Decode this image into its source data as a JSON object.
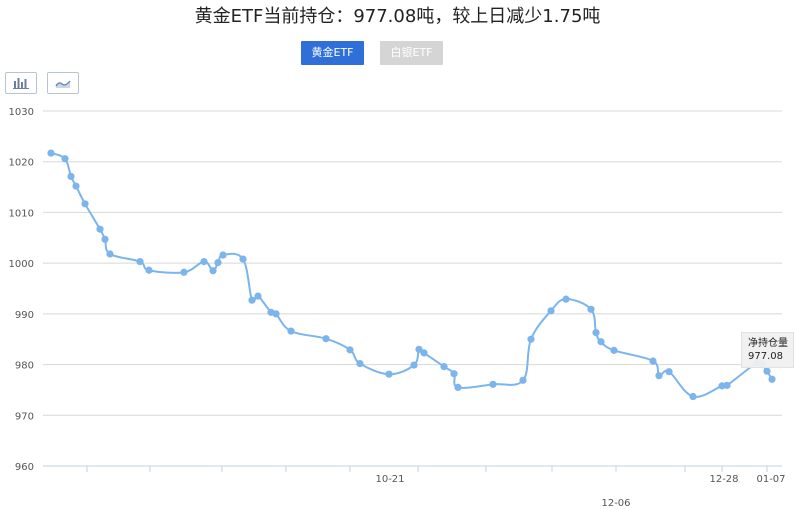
{
  "title": "黄金ETF当前持仓：977.08吨，较上日减少1.75吨",
  "tabs": [
    {
      "label": "黄金ETF",
      "active": true
    },
    {
      "label": "白银ETF",
      "active": false
    }
  ],
  "tools": [
    {
      "icon": "bar-chart-icon"
    },
    {
      "icon": "line-chart-icon"
    }
  ],
  "tooltip": {
    "label": "净持仓量",
    "value": "977.08"
  },
  "colors": {
    "line": "#7cb5ec",
    "active_tab": "#2f6fd8",
    "inactive_tab": "#d5d5d5",
    "grid": "#d8d8d8"
  },
  "chart_data": {
    "type": "line",
    "ylim": [
      960,
      1030
    ],
    "yticks": [
      "1030",
      "1020",
      "1010",
      "1000",
      "990",
      "980",
      "970",
      "960"
    ],
    "xticks_row1": [
      "10-21",
      "12-28",
      "01-07"
    ],
    "xticks_row2": [
      "12-06"
    ],
    "grid": true,
    "legend": "none",
    "series": [
      {
        "values": [
          1021.7,
          1020.6,
          1017.1,
          1015.2,
          1011.7,
          1006.7,
          1004.7,
          1001.8,
          1000.3,
          998.6,
          998.2,
          1000.3,
          998.5,
          1000.1,
          1001.6,
          1000.8,
          992.7,
          993.5,
          990.3,
          990.0,
          986.6,
          985.1,
          982.9,
          980.2,
          978.1,
          979.9,
          983.0,
          982.3,
          979.6,
          978.2,
          975.5,
          976.1,
          976.9,
          985.0,
          990.6,
          992.9,
          990.9,
          986.3,
          984.5,
          982.8,
          980.7,
          977.8,
          978.6,
          973.7,
          975.8,
          975.9,
          980.4,
          980.1,
          978.7,
          977.1
        ]
      }
    ]
  }
}
